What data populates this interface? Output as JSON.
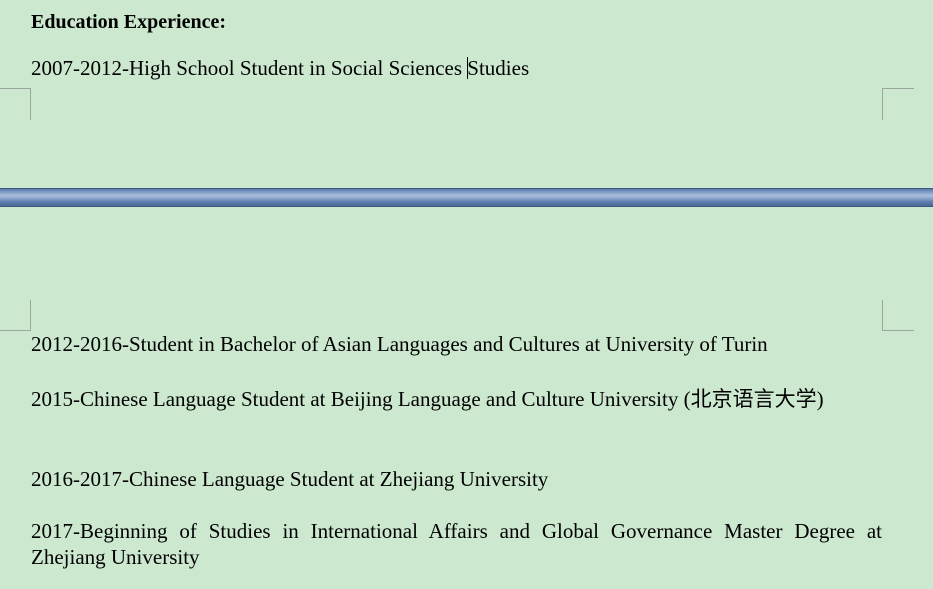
{
  "document": {
    "heading": "Education Experience:",
    "entry_1_before_caret": "2007-2012-High School Student in Social Sciences ",
    "entry_1_after_caret": "Studies",
    "entry_2": "2012-2016-Student in Bachelor of Asian Languages and Cultures at University of Turin",
    "entry_3": "2015-Chinese Language Student at Beijing Language and Culture University (北京语言大学)",
    "entry_4": "2016-2017-Chinese Language Student at Zhejiang University",
    "entry_5": "2017-Beginning of Studies in International Affairs and Global Governance Master Degree at Zhejiang University"
  },
  "colors": {
    "page_background": "#cce8cf",
    "page_gap": "#6f8fbe",
    "text": "#000000"
  }
}
